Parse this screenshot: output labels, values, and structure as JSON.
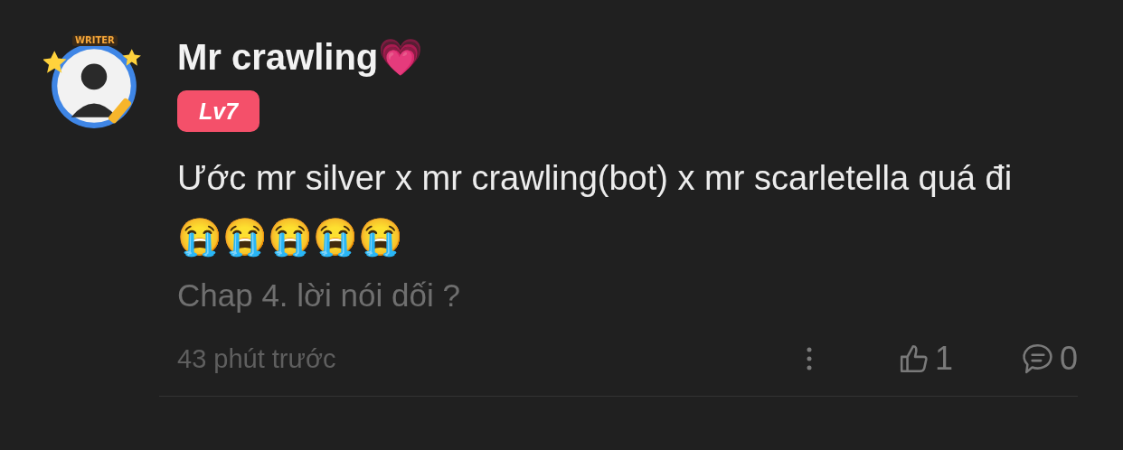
{
  "comment": {
    "avatar": {
      "frame_label": "WRITER"
    },
    "author": "Mr crawling💗",
    "level_badge": "Lv7",
    "text": "Ước mr silver x mr crawling(bot) x mr scarletella quá đi",
    "emoji_line": "😭😭😭😭😭",
    "chapter": "Chap 4. lời nói dối ?",
    "time": "43 phút trước",
    "likes": "1",
    "replies": "0"
  }
}
